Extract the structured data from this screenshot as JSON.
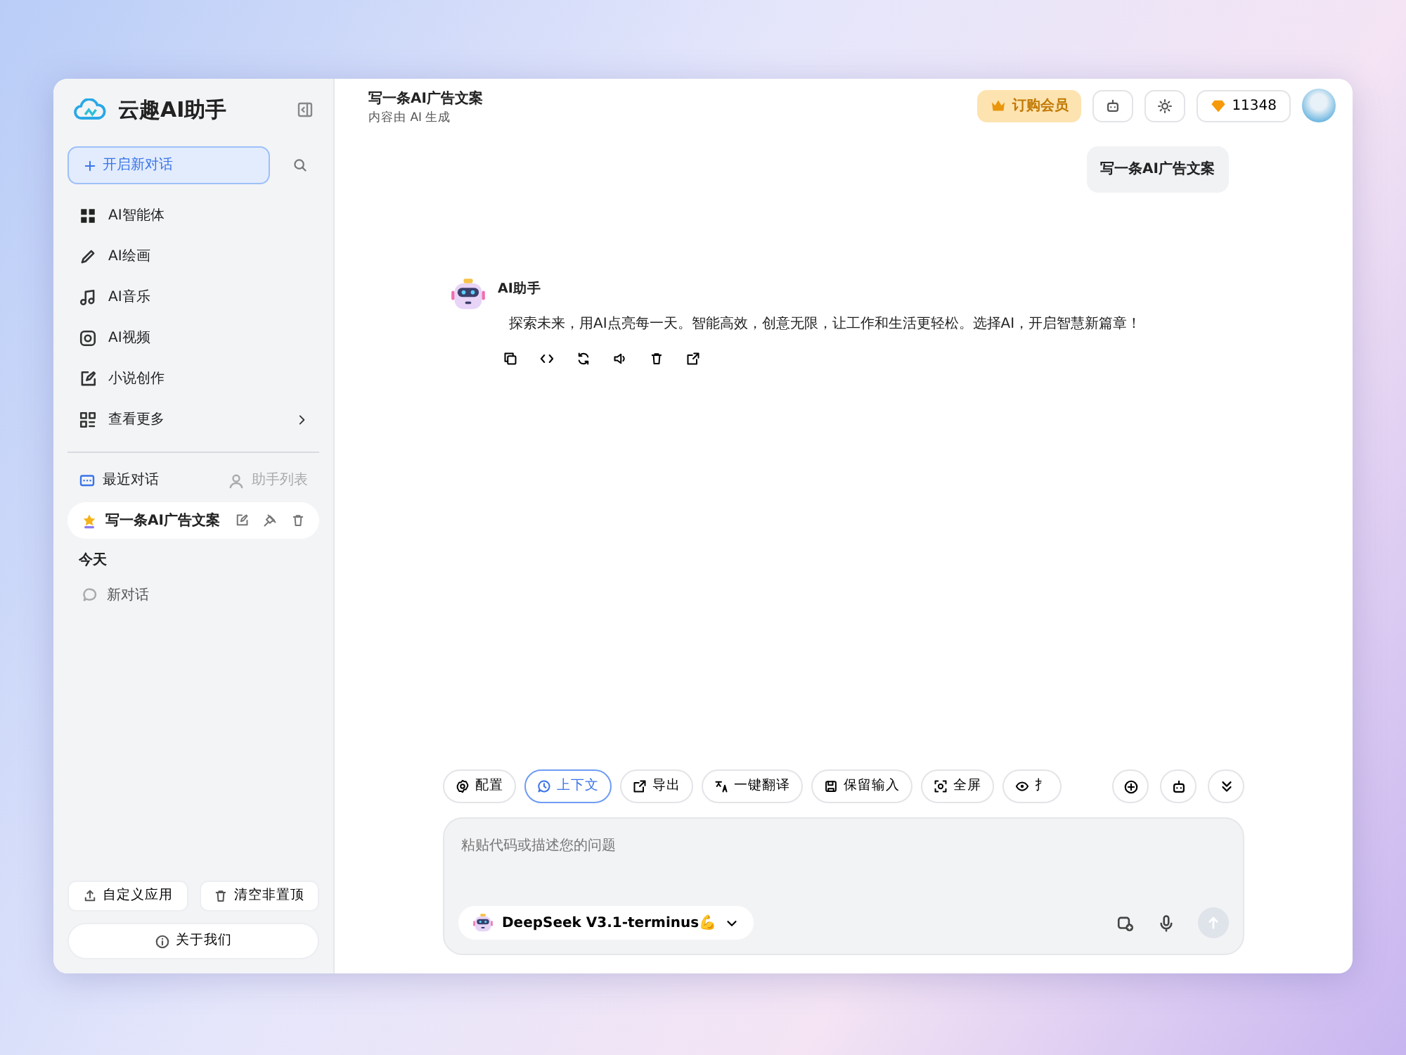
{
  "sidebar": {
    "brand": "云趣AI助手",
    "new_chat": "开启新对话",
    "nav": [
      {
        "label": "AI智能体",
        "kind": "link"
      },
      {
        "label": "AI绘画",
        "kind": "link"
      },
      {
        "label": "AI音乐",
        "kind": "link"
      },
      {
        "label": "AI视频",
        "kind": "link"
      },
      {
        "label": "小说创作",
        "kind": "link"
      },
      {
        "label": "查看更多",
        "kind": "more"
      }
    ],
    "tabs": [
      {
        "label": "最近对话",
        "selected": true
      },
      {
        "label": "助手列表",
        "selected": false
      }
    ],
    "pinned": [
      {
        "title": "写一条AI广告文案",
        "selected": true
      }
    ],
    "groups": [
      {
        "label": "今天",
        "items": [
          {
            "title": "新对话",
            "selected": false
          }
        ]
      }
    ],
    "footer_buttons": [
      "自定义应用",
      "清空非置顶"
    ],
    "about": "关于我们"
  },
  "header": {
    "title": "写一条AI广告文案",
    "subtitle": "内容由 AI 生成",
    "subscribe": "订购会员",
    "points": "11348"
  },
  "messages": [
    {
      "kind": "user",
      "text": "写一条AI广告文案"
    },
    {
      "kind": "assistant",
      "name": "AI助手",
      "text": "探索未来，用AI点亮每一天。智能高效，创意无限，让工作和生活更轻松。选择AI，开启智慧新篇章！"
    }
  ],
  "toolbar": [
    {
      "label": "配置",
      "selected": false
    },
    {
      "label": "上下文",
      "selected": true
    },
    {
      "label": "导出",
      "selected": false
    },
    {
      "label": "一键翻译",
      "selected": false
    },
    {
      "label": "保留输入",
      "selected": false
    },
    {
      "label": "全屏",
      "selected": false
    },
    {
      "label": "扌",
      "selected": false
    }
  ],
  "input": {
    "placeholder": "粘贴代码或描述您的问题",
    "model": "DeepSeek V3.1-terminus💪"
  }
}
